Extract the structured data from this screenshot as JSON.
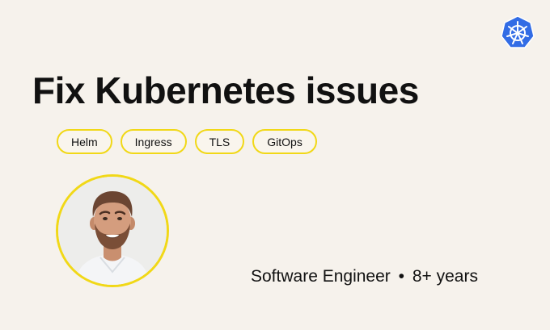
{
  "headline": "Fix Kubernetes issues",
  "tags": [
    {
      "label": "Helm"
    },
    {
      "label": "Ingress"
    },
    {
      "label": "TLS"
    },
    {
      "label": "GitOps"
    }
  ],
  "subtitle": {
    "role": "Software Engineer",
    "separator": "•",
    "experience": "8+ years"
  },
  "logo": {
    "icon": "kubernetes-helm-wheel-icon",
    "color": "#326ce5"
  },
  "avatar": {
    "icon": "person-portrait",
    "ring_color": "#f1d817"
  },
  "colors": {
    "background": "#f6f2ec",
    "accent_yellow": "#f1d817",
    "text": "#111111"
  }
}
